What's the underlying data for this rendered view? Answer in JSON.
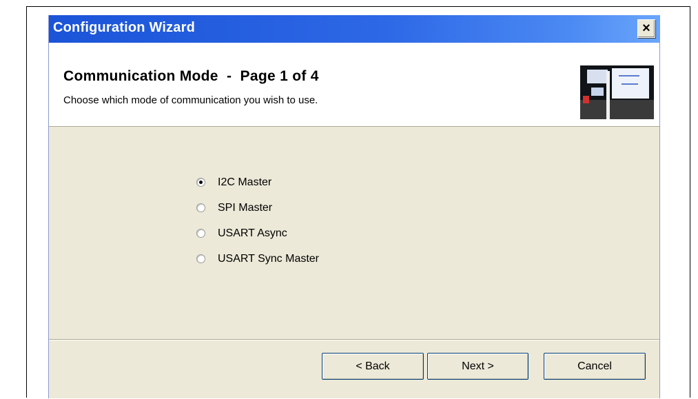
{
  "window": {
    "title": "Configuration Wizard",
    "close_glyph": "×"
  },
  "header": {
    "title": "Communication Mode  -  Page 1 of 4",
    "subtitle": "Choose which mode of communication you wish to use.",
    "image_icon": "wizard-banner-image"
  },
  "options": {
    "items": [
      {
        "label": "I2C Master",
        "checked": true
      },
      {
        "label": "SPI Master",
        "checked": false
      },
      {
        "label": "USART Async",
        "checked": false
      },
      {
        "label": "USART Sync Master",
        "checked": false
      }
    ]
  },
  "buttons": {
    "back_label": "< Back",
    "next_label": "Next >",
    "cancel_label": "Cancel"
  }
}
